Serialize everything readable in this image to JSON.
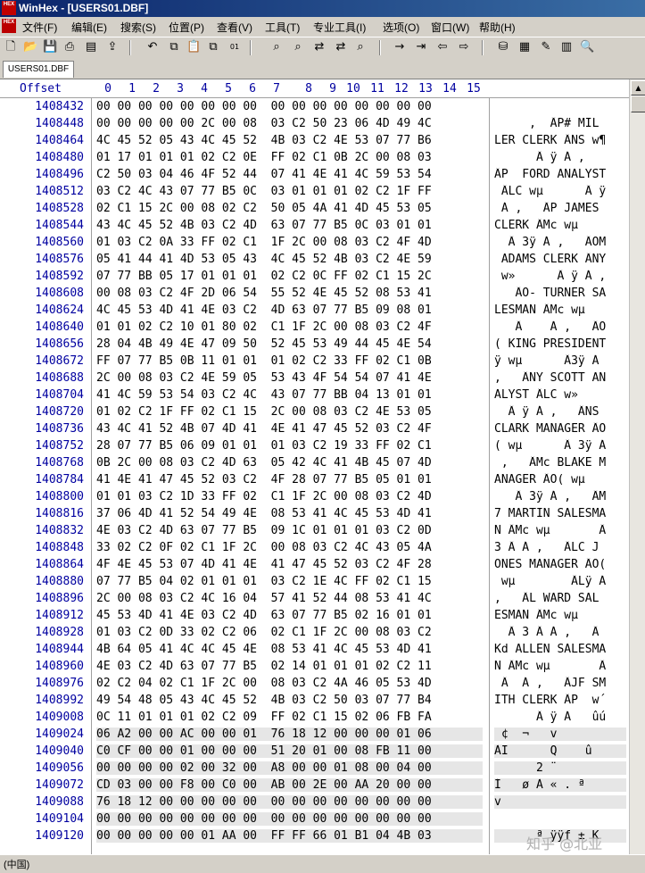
{
  "window": {
    "title": "WinHex - [USERS01.DBF]",
    "logo_text": "HEX"
  },
  "menu": [
    "文件(F)",
    "编辑(E)",
    "搜索(S)",
    "位置(P)",
    "查看(V)",
    "工具(T)",
    "专业工具(I)",
    "选项(O)",
    "窗口(W)",
    "帮助(H)"
  ],
  "toolbar_icons": [
    "new-icon",
    "open-icon",
    "save-icon",
    "print-icon",
    "properties-icon",
    "export-icon",
    "undo-icon",
    "copy-icon",
    "paste-icon",
    "paste-special-icon",
    "hex-convert-icon",
    "find-icon",
    "find-hex-icon",
    "replace-icon",
    "replace-hex-icon",
    "find-next-icon",
    "goto-icon",
    "goto-offset-icon",
    "back-icon",
    "forward-icon",
    "disk-icon",
    "ram-icon",
    "tools-icon",
    "calculator-icon",
    "search-icon"
  ],
  "tab": {
    "label": "USERS01.DBF"
  },
  "header": {
    "offset_label": "Offset",
    "columns": [
      "0",
      "1",
      "2",
      "3",
      "4",
      "5",
      "6",
      "7",
      "8",
      "9",
      "10",
      "11",
      "12",
      "13",
      "14",
      "15"
    ]
  },
  "rows": [
    {
      "offset": "1408432",
      "hex": "00 00 00 00 00 00 00 00  00 00 00 00 00 00 00 00",
      "text": ""
    },
    {
      "offset": "1408448",
      "hex": "00 00 00 00 00 2C 00 08  03 C2 50 23 06 4D 49 4C",
      "text": "     ,  ÂP# MIL"
    },
    {
      "offset": "1408464",
      "hex": "4C 45 52 05 43 4C 45 52  4B 03 C2 4E 53 07 77 B6",
      "text": "LER CLERK ÂNS w¶"
    },
    {
      "offset": "1408480",
      "hex": "01 17 01 01 01 02 C2 0E  FF 02 C1 0B 2C 00 08 03",
      "text": "      Â ÿ Á ,  "
    },
    {
      "offset": "1408496",
      "hex": "C2 50 03 04 46 4F 52 44  07 41 4E 41 4C 59 53 54",
      "text": "ÂP  FORD ANALYST"
    },
    {
      "offset": "1408512",
      "hex": "03 C2 4C 43 07 77 B5 0C  03 01 01 01 02 C2 1F FF",
      "text": " ÂLC wµ      Â ÿ"
    },
    {
      "offset": "1408528",
      "hex": "02 C1 15 2C 00 08 02 C2  50 05 4A 41 4D 45 53 05",
      "text": " Á ,   ÂP JAMES "
    },
    {
      "offset": "1408544",
      "hex": "43 4C 45 52 4B 03 C2 4D  63 07 77 B5 0C 03 01 01",
      "text": "CLERK ÂMc wµ    "
    },
    {
      "offset": "1408560",
      "hex": "01 03 C2 0A 33 FF 02 C1  1F 2C 00 08 03 C2 4F 4D",
      "text": "  Â 3ÿ Á ,   ÂOM"
    },
    {
      "offset": "1408576",
      "hex": "05 41 44 41 4D 53 05 43  4C 45 52 4B 03 C2 4E 59",
      "text": " ADAMS CLERK ÂNY"
    },
    {
      "offset": "1408592",
      "hex": "07 77 BB 05 17 01 01 01  02 C2 0C FF 02 C1 15 2C",
      "text": " w»      Â ÿ Á ,"
    },
    {
      "offset": "1408608",
      "hex": "00 08 03 C2 4F 2D 06 54  55 52 4E 45 52 08 53 41",
      "text": "   ÂO- TURNER SA"
    },
    {
      "offset": "1408624",
      "hex": "4C 45 53 4D 41 4E 03 C2  4D 63 07 77 B5 09 08 01",
      "text": "LESMAN ÂMc wµ   "
    },
    {
      "offset": "1408640",
      "hex": "01 01 02 C2 10 01 80 02  C1 1F 2C 00 08 03 C2 4F",
      "text": "   Â    Á ,   ÂO"
    },
    {
      "offset": "1408656",
      "hex": "28 04 4B 49 4E 47 09 50  52 45 53 49 44 45 4E 54",
      "text": "( KING PRESIDENT"
    },
    {
      "offset": "1408672",
      "hex": "FF 07 77 B5 0B 11 01 01  01 02 C2 33 FF 02 C1 0B",
      "text": "ÿ wµ      Â3ÿ Á "
    },
    {
      "offset": "1408688",
      "hex": "2C 00 08 03 C2 4E 59 05  53 43 4F 54 54 07 41 4E",
      "text": ",   ÂNY SCOTT AN"
    },
    {
      "offset": "1408704",
      "hex": "41 4C 59 53 54 03 C2 4C  43 07 77 BB 04 13 01 01",
      "text": "ALYST ÂLC w»    "
    },
    {
      "offset": "1408720",
      "hex": "01 02 C2 1F FF 02 C1 15  2C 00 08 03 C2 4E 53 05",
      "text": "  Â ÿ Á ,   ÂNS "
    },
    {
      "offset": "1408736",
      "hex": "43 4C 41 52 4B 07 4D 41  4E 41 47 45 52 03 C2 4F",
      "text": "CLARK MANAGER ÂO"
    },
    {
      "offset": "1408752",
      "hex": "28 07 77 B5 06 09 01 01  01 03 C2 19 33 FF 02 C1",
      "text": "( wµ      Â 3ÿ Á"
    },
    {
      "offset": "1408768",
      "hex": "0B 2C 00 08 03 C2 4D 63  05 42 4C 41 4B 45 07 4D",
      "text": " ,   ÂMc BLAKE M"
    },
    {
      "offset": "1408784",
      "hex": "41 4E 41 47 45 52 03 C2  4F 28 07 77 B5 05 01 01",
      "text": "ANAGER ÂO( wµ   "
    },
    {
      "offset": "1408800",
      "hex": "01 01 03 C2 1D 33 FF 02  C1 1F 2C 00 08 03 C2 4D",
      "text": "   Â 3ÿ Á ,   ÂM"
    },
    {
      "offset": "1408816",
      "hex": "37 06 4D 41 52 54 49 4E  08 53 41 4C 45 53 4D 41",
      "text": "7 MARTIN SALESMA"
    },
    {
      "offset": "1408832",
      "hex": "4E 03 C2 4D 63 07 77 B5  09 1C 01 01 01 03 C2 0D",
      "text": "N ÂMc wµ       Â"
    },
    {
      "offset": "1408848",
      "hex": "33 02 C2 0F 02 C1 1F 2C  00 08 03 C2 4C 43 05 4A",
      "text": "3 Â Á ,   ÂLC J"
    },
    {
      "offset": "1408864",
      "hex": "4F 4E 45 53 07 4D 41 4E  41 47 45 52 03 C2 4F 28",
      "text": "ONES MANAGER ÂO("
    },
    {
      "offset": "1408880",
      "hex": "07 77 B5 04 02 01 01 01  03 C2 1E 4C FF 02 C1 15",
      "text": " wµ        ÂLÿ Á"
    },
    {
      "offset": "1408896",
      "hex": "2C 00 08 03 C2 4C 16 04  57 41 52 44 08 53 41 4C",
      "text": ",   ÂL WARD SAL"
    },
    {
      "offset": "1408912",
      "hex": "45 53 4D 41 4E 03 C2 4D  63 07 77 B5 02 16 01 01",
      "text": "ESMAN ÂMc wµ    "
    },
    {
      "offset": "1408928",
      "hex": "01 03 C2 0D 33 02 C2 06  02 C1 1F 2C 00 08 03 C2",
      "text": "  Â 3 Â Á ,   Â"
    },
    {
      "offset": "1408944",
      "hex": "4B 64 05 41 4C 4C 45 4E  08 53 41 4C 45 53 4D 41",
      "text": "Kd ALLEN SALESMA"
    },
    {
      "offset": "1408960",
      "hex": "4E 03 C2 4D 63 07 77 B5  02 14 01 01 01 02 C2 11",
      "text": "N ÂMc wµ       Â"
    },
    {
      "offset": "1408976",
      "hex": "02 C2 04 02 C1 1F 2C 00  08 03 C2 4A 46 05 53 4D",
      "text": " Â  Á ,   ÂJF SM"
    },
    {
      "offset": "1408992",
      "hex": "49 54 48 05 43 4C 45 52  4B 03 C2 50 03 07 77 B4",
      "text": "ITH CLERK ÂP  w´"
    },
    {
      "offset": "1409008",
      "hex": "0C 11 01 01 01 02 C2 09  FF 02 C1 15 02 06 FB FA",
      "text": "      Â ÿ Á   ûú"
    },
    {
      "offset": "1409024",
      "hex": "06 A2 00 00 AC 00 00 01  76 18 12 00 00 00 01 06",
      "text": " ¢  ¬   v       "
    },
    {
      "offset": "1409040",
      "hex": "C0 CF 00 00 01 00 00 00  51 20 01 00 08 FB 11 00",
      "text": "ÀÏ      Q    û  "
    },
    {
      "offset": "1409056",
      "hex": "00 00 00 00 02 00 32 00  A8 00 00 01 08 00 04 00",
      "text": "      2 ¨       "
    },
    {
      "offset": "1409072",
      "hex": "CD 03 00 00 F8 00 C0 00  AB 00 2E 00 AA 20 00 00",
      "text": "Í   ø À « . ª   "
    },
    {
      "offset": "1409088",
      "hex": "76 18 12 00 00 00 00 00  00 00 00 00 00 00 00 00",
      "text": "v               "
    },
    {
      "offset": "1409104",
      "hex": "00 00 00 00 00 00 00 00  00 00 00 00 00 00 00 00",
      "text": ""
    },
    {
      "offset": "1409120",
      "hex": "00 00 00 00 00 01 AA 00  FF FF 66 01 B1 04 4B 03",
      "text": "      ª ÿÿf ± K "
    }
  ],
  "status": {
    "text": "(中国)"
  },
  "watermark": "知乎 @北亚"
}
